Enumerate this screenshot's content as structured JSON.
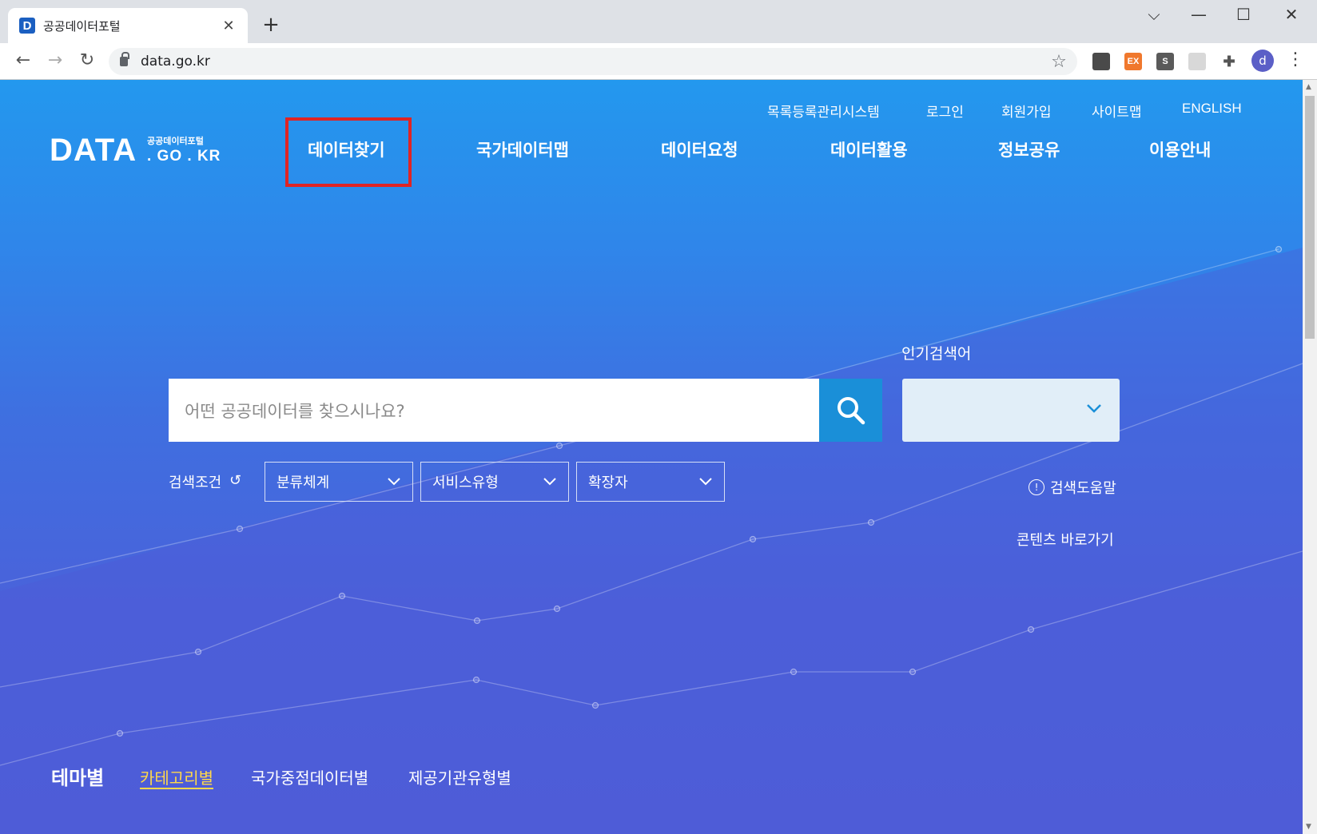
{
  "browser": {
    "tab_title": "공공데이터포털",
    "favicon_letter": "D",
    "new_tab": "+",
    "url": "data.go.kr",
    "window_controls": [
      "minimize",
      "maximize",
      "close"
    ],
    "extensions": [
      {
        "icon": "dark-square-extension",
        "label": "",
        "color": "#4a4a4a"
      },
      {
        "icon": "ex-extension",
        "label": "EX",
        "color": "#f0782d"
      },
      {
        "icon": "s-extension",
        "label": "S",
        "color": "#5a5a5a"
      },
      {
        "icon": "gray-extension",
        "label": "",
        "color": "#d8d8d8"
      },
      {
        "icon": "puzzle-icon",
        "label": ""
      }
    ],
    "profile_initial": "d"
  },
  "header": {
    "util_links": [
      "목록등록관리시스템",
      "로그인",
      "회원가입",
      "사이트맵",
      "ENGLISH"
    ],
    "logo": {
      "main": "DATA",
      "sub": "공공데이터포털",
      "domain": ". GO . KR"
    },
    "gnb": [
      "데이터찾기",
      "국가데이터맵",
      "데이터요청",
      "데이터활용",
      "정보공유",
      "이용안내"
    ],
    "highlighted_item": "데이터찾기",
    "highlight_color": "#e02424"
  },
  "search": {
    "placeholder": "어떤 공공데이터를 찾으시나요?",
    "button_color": "#1a8fd8",
    "popular_label": "인기검색어",
    "popular_value": "",
    "condition_label": "검색조건",
    "filters": [
      "분류체계",
      "서비스유형",
      "확장자"
    ],
    "help_label": "검색도움말",
    "shortcut_label": "콘텐츠 바로가기"
  },
  "bottom_tabs": {
    "items": [
      "테마별",
      "카테고리별",
      "국가중점데이터별",
      "제공기관유형별"
    ],
    "active": "테마별",
    "hover": "카테고리별",
    "hover_color": "#ffd84a"
  }
}
